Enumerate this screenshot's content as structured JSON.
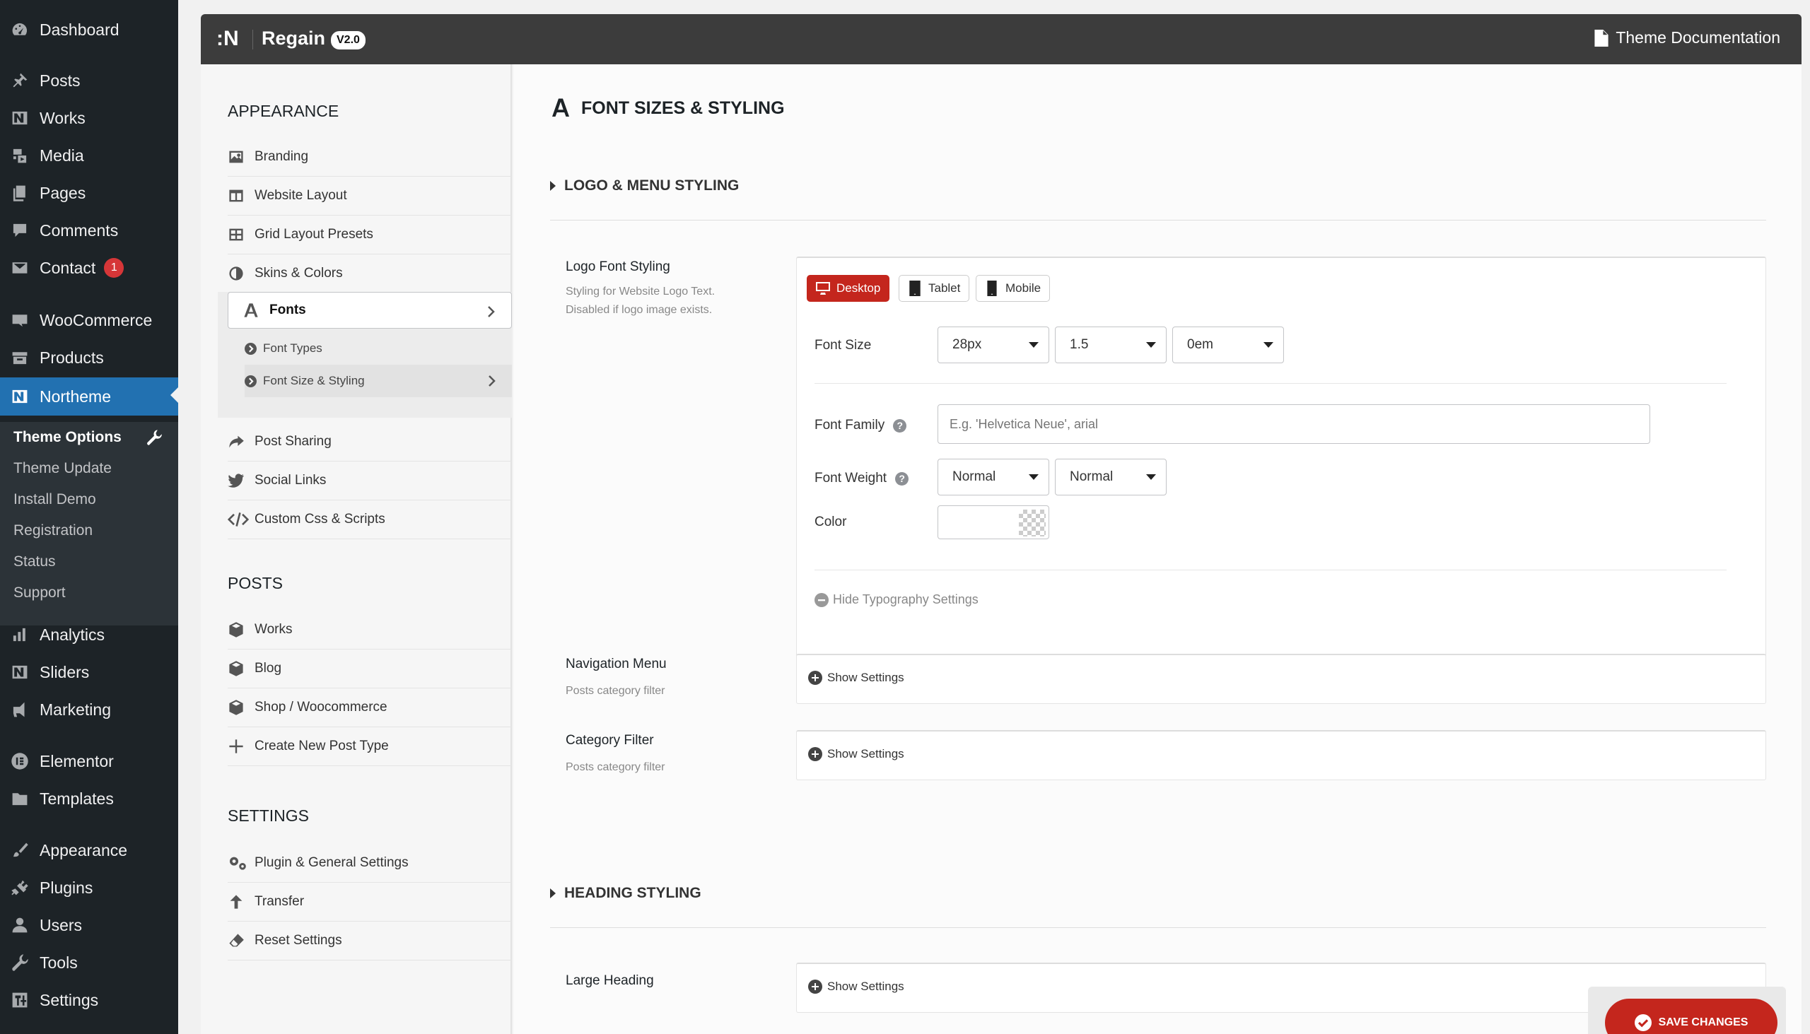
{
  "wp_menu": {
    "dashboard": "Dashboard",
    "posts": "Posts",
    "works": "Works",
    "media": "Media",
    "pages": "Pages",
    "comments": "Comments",
    "contact": "Contact",
    "contact_badge": "1",
    "woocommerce": "WooCommerce",
    "products": "Products",
    "northeme": "Northeme",
    "analytics": "Analytics",
    "sliders": "Sliders",
    "marketing": "Marketing",
    "elementor": "Elementor",
    "templates": "Templates",
    "appearance": "Appearance",
    "plugins": "Plugins",
    "users": "Users",
    "tools": "Tools",
    "settings": "Settings",
    "submenu": {
      "theme_options": "Theme Options",
      "theme_update": "Theme Update",
      "install_demo": "Install Demo",
      "registration": "Registration",
      "status": "Status",
      "support": "Support"
    }
  },
  "header": {
    "logo": ":N",
    "title": "Regain",
    "version": "V2.0",
    "docs_label": "Theme Documentation"
  },
  "options_nav": {
    "appearance_heading": "APPEARANCE",
    "appearance_items": {
      "branding": "Branding",
      "website_layout": "Website Layout",
      "grid_layout_presets": "Grid Layout Presets",
      "skins_colors": "Skins & Colors",
      "fonts": "Fonts",
      "font_types": "Font Types",
      "font_size_styling": "Font Size & Styling",
      "post_sharing": "Post Sharing",
      "social_links": "Social Links",
      "custom_css": "Custom Css & Scripts"
    },
    "posts_heading": "POSTS",
    "posts_items": {
      "works": "Works",
      "blog": "Blog",
      "shop": "Shop / Woocommerce",
      "create_new": "Create New Post Type"
    },
    "settings_heading": "SETTINGS",
    "settings_items": {
      "plugin_general": "Plugin & General Settings",
      "transfer": "Transfer",
      "reset": "Reset Settings"
    }
  },
  "main": {
    "page_title": "FONT SIZES & STYLING",
    "logo_menu_section": "LOGO & MENU STYLING",
    "logo_font": {
      "label": "Logo Font Styling",
      "desc_line1": "Styling for Website Logo Text.",
      "desc_line2": "Disabled if logo image exists.",
      "devices": {
        "desktop": "Desktop",
        "tablet": "Tablet",
        "mobile": "Mobile"
      },
      "font_size_label": "Font Size",
      "font_size_value": "28px",
      "line_height_value": "1.5",
      "letter_spacing_value": "0em",
      "font_family_label": "Font Family",
      "font_family_placeholder": "E.g. 'Helvetica Neue', arial",
      "font_family_value": "",
      "font_weight_label": "Font Weight",
      "font_weight_value": "Normal",
      "font_style_value": "Normal",
      "color_label": "Color",
      "hide_settings": "Hide Typography Settings"
    },
    "navigation_menu": {
      "label": "Navigation Menu",
      "desc": "Posts category filter",
      "show": "Show Settings"
    },
    "category_filter": {
      "label": "Category Filter",
      "desc": "Posts category filter",
      "show": "Show Settings"
    },
    "heading_section": "HEADING STYLING",
    "large_heading": {
      "label": "Large Heading",
      "show": "Show Settings"
    },
    "save_label": "SAVE CHANGES"
  },
  "colors": {
    "wp_sidebar": "#1d2327",
    "wp_active": "#2271b1",
    "accent_red": "#c4261d",
    "topbar": "#3c3c3c"
  }
}
